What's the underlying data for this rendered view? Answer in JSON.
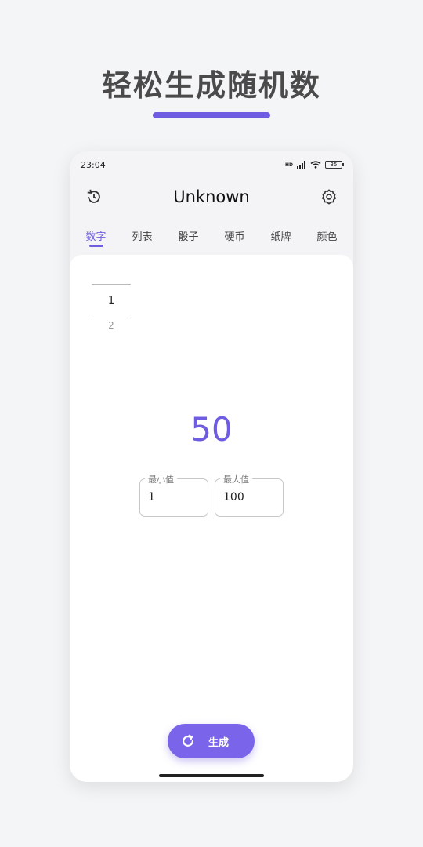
{
  "promo": {
    "title": "轻松生成随机数"
  },
  "status": {
    "time": "23:04",
    "hd": "HD",
    "battery": "35"
  },
  "appbar": {
    "title": "Unknown",
    "history_icon": "history-icon",
    "settings_icon": "gear-icon"
  },
  "tabs": [
    {
      "label": "数字",
      "active": true
    },
    {
      "label": "列表",
      "active": false
    },
    {
      "label": "骰子",
      "active": false
    },
    {
      "label": "硬币",
      "active": false
    },
    {
      "label": "纸牌",
      "active": false
    },
    {
      "label": "颜色",
      "active": false
    }
  ],
  "picker": {
    "selected": "1",
    "next": "2"
  },
  "result": {
    "value": "50"
  },
  "range": {
    "min_label": "最小值",
    "min_value": "1",
    "max_label": "最大值",
    "max_value": "100"
  },
  "generate": {
    "label": "生成",
    "icon": "refresh-icon"
  },
  "colors": {
    "accent": "#6e5de0"
  }
}
